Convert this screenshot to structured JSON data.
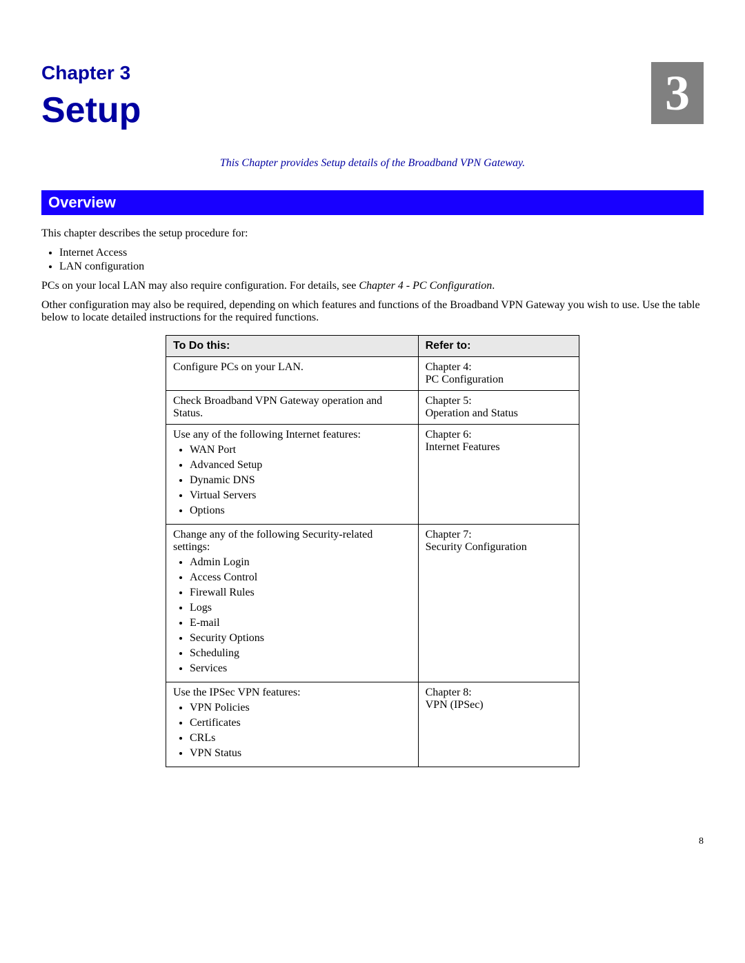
{
  "chapter": {
    "label": "Chapter 3",
    "title": "Setup",
    "number": "3",
    "intro": "This Chapter provides Setup details of the Broadband VPN Gateway."
  },
  "section_heading": "Overview",
  "body": {
    "p1": "This chapter describes the setup procedure for:",
    "list1": [
      "Internet Access",
      "LAN configuration"
    ],
    "p2_a": "PCs on your local LAN may also require configuration. For details, see ",
    "p2_ref": "Chapter 4 - PC Configuration",
    "p2_b": ".",
    "p3": "Other configuration may also be required, depending on which features and functions of the Broadband VPN Gateway you wish to use. Use the table below to locate detailed instructions for the required functions."
  },
  "table": {
    "headers": {
      "left": "To Do this:",
      "right": "Refer to:"
    },
    "rows": [
      {
        "task": "Configure PCs on your LAN.",
        "items": [],
        "ref_line1": "Chapter 4:",
        "ref_line2": "PC Configuration"
      },
      {
        "task": "Check Broadband VPN Gateway operation and Status.",
        "items": [],
        "ref_line1": "Chapter 5:",
        "ref_line2": "Operation and Status"
      },
      {
        "task": "Use any of the following Internet features:",
        "items": [
          "WAN Port",
          "Advanced Setup",
          "Dynamic DNS",
          "Virtual Servers",
          "Options"
        ],
        "ref_line1": "Chapter 6:",
        "ref_line2": "Internet Features"
      },
      {
        "task": "Change any of the following Security-related settings:",
        "items": [
          "Admin Login",
          "Access Control",
          "Firewall Rules",
          "Logs",
          "E-mail",
          "Security Options",
          "Scheduling",
          "Services"
        ],
        "ref_line1": "Chapter 7:",
        "ref_line2": "Security Configuration"
      },
      {
        "task": "Use the IPSec VPN features:",
        "items": [
          "VPN Policies",
          "Certificates",
          "CRLs",
          "VPN Status"
        ],
        "ref_line1": "Chapter 8:",
        "ref_line2": "VPN (IPSec)"
      }
    ]
  },
  "page_number": "8"
}
